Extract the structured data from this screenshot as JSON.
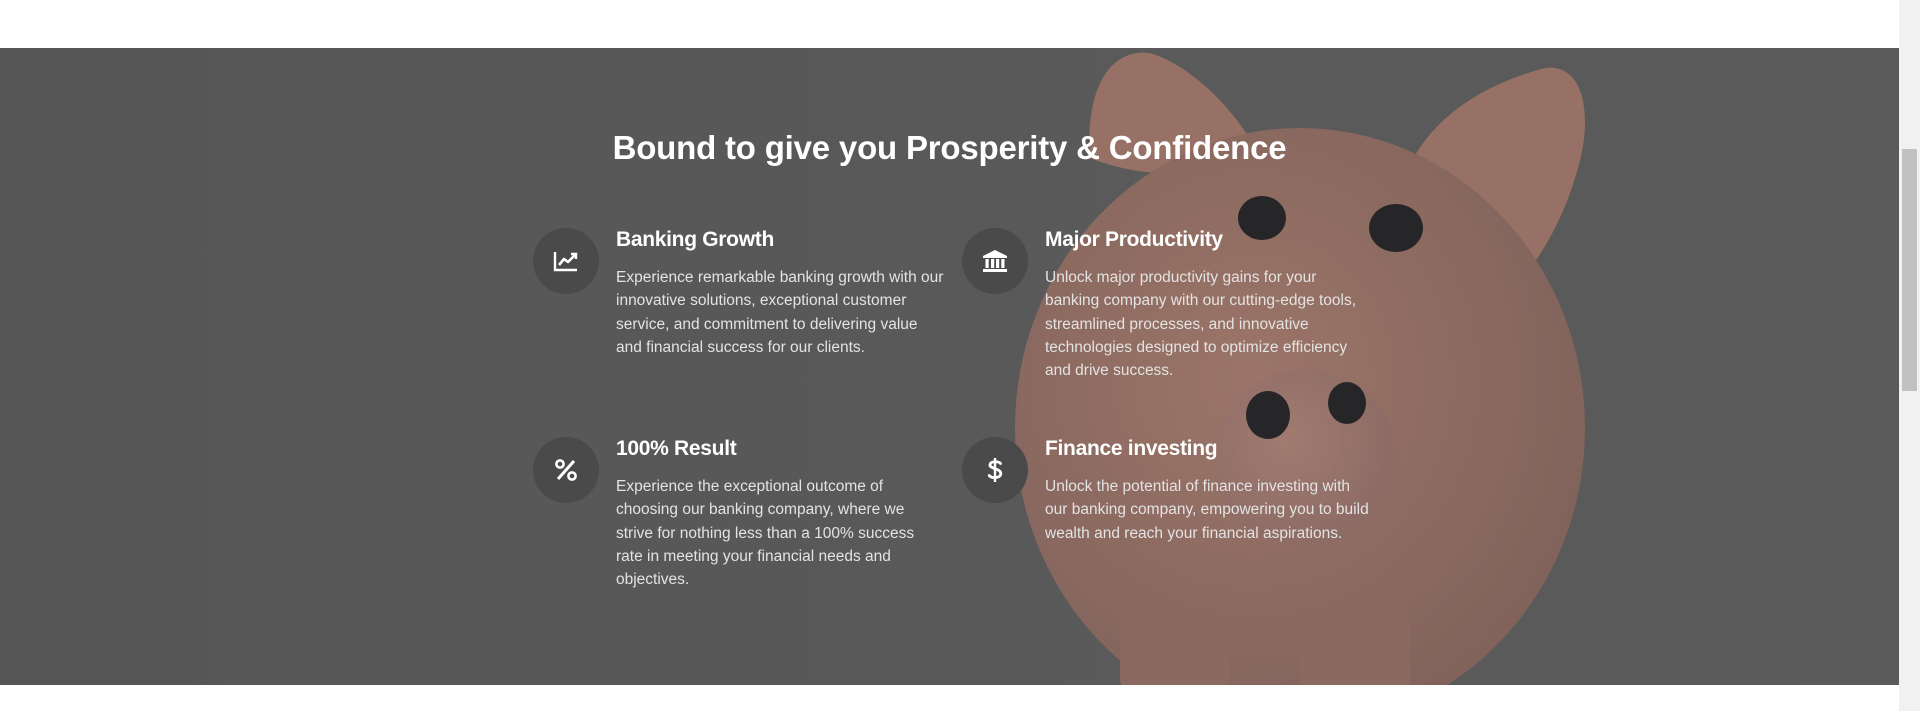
{
  "section": {
    "headline": "Bound to give you Prosperity & Confidence"
  },
  "features": [
    {
      "title": "Banking Growth",
      "description": "Experience remarkable banking growth with our innovative solutions, exceptional customer service, and commitment to delivering value and financial success for our clients.",
      "icon": "chart-line-icon"
    },
    {
      "title": "Major Productivity",
      "description": "Unlock major productivity gains for your banking company with our cutting-edge tools, streamlined processes, and innovative technologies designed to optimize efficiency and drive success.",
      "icon": "bank-icon"
    },
    {
      "title": "100% Result",
      "description": "Experience the exceptional outcome of choosing our banking company, where we strive for nothing less than a 100% success rate in meeting your financial needs and objectives.",
      "icon": "percent-icon"
    },
    {
      "title": "Finance investing",
      "description": "Unlock the potential of finance investing with our banking company, empowering you to build wealth and reach your financial aspirations.",
      "icon": "dollar-icon"
    }
  ],
  "colors": {
    "overlay": "#5c5c5c",
    "icon_circle": "#4a4a4a",
    "heading_text": "#ffffff",
    "body_text": "#e3e3e3",
    "piggy_bank": "#c98a78"
  }
}
